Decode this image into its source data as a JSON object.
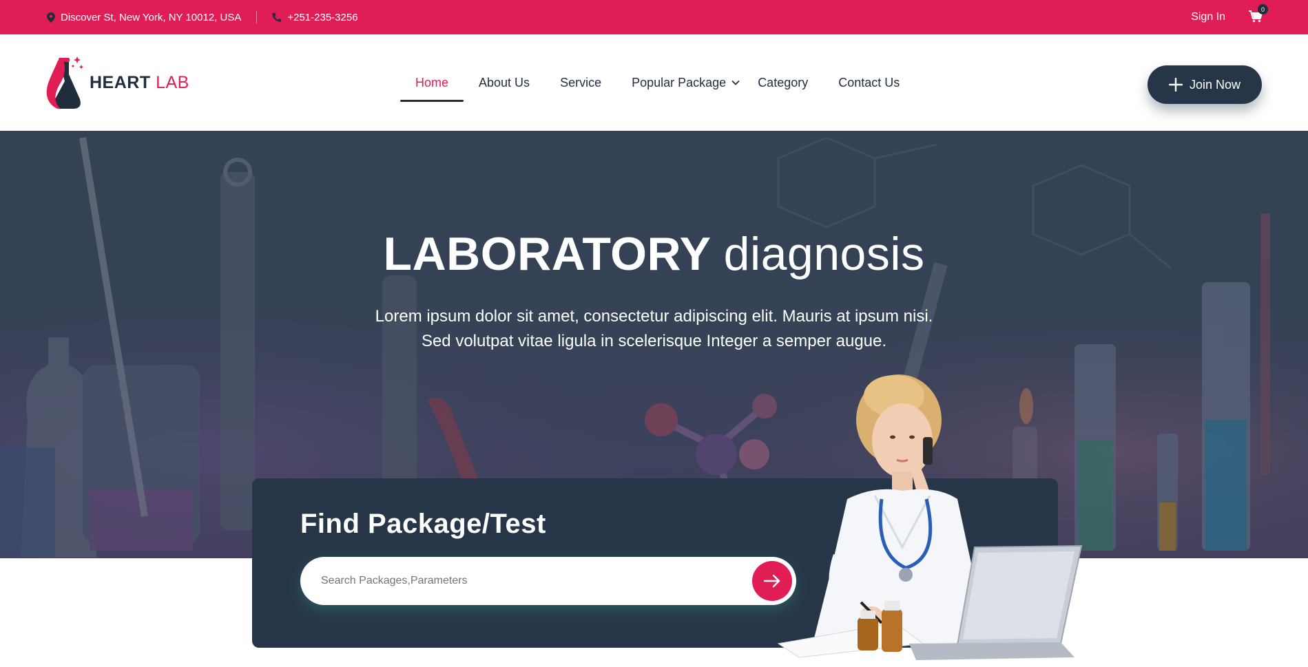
{
  "topbar": {
    "address": "Discover St, New York, NY 10012, USA",
    "phone": "+251-235-3256",
    "signin_label": "Sign In",
    "cart_count": "0"
  },
  "header": {
    "logo": {
      "heart": "HEART",
      "lab": "LAB"
    },
    "nav": [
      {
        "label": "Home",
        "active": true
      },
      {
        "label": "About Us"
      },
      {
        "label": "Service"
      },
      {
        "label": "Popular Package",
        "has_dropdown": true
      },
      {
        "label": "Category"
      },
      {
        "label": "Contact Us"
      }
    ],
    "join_label": "Join Now"
  },
  "hero": {
    "title_bold": "LABORATORY",
    "title_light": "diagnosis",
    "subtitle_line1": "Lorem ipsum dolor sit amet, consectetur adipiscing elit. Mauris at ipsum nisi.",
    "subtitle_line2": "Sed volutpat vitae ligula in scelerisque Integer a semper augue."
  },
  "search_panel": {
    "title": "Find Package/Test",
    "placeholder": "Search Packages,Parameters"
  },
  "colors": {
    "accent": "#e11d55",
    "dark": "#263648",
    "text": "#1f2d3d"
  },
  "icons": {
    "address": "map-pin-icon",
    "phone": "phone-icon",
    "cart": "cart-icon",
    "join": "plus-icon",
    "search_submit": "arrow-right-icon",
    "dropdown": "chevron-down-icon"
  }
}
